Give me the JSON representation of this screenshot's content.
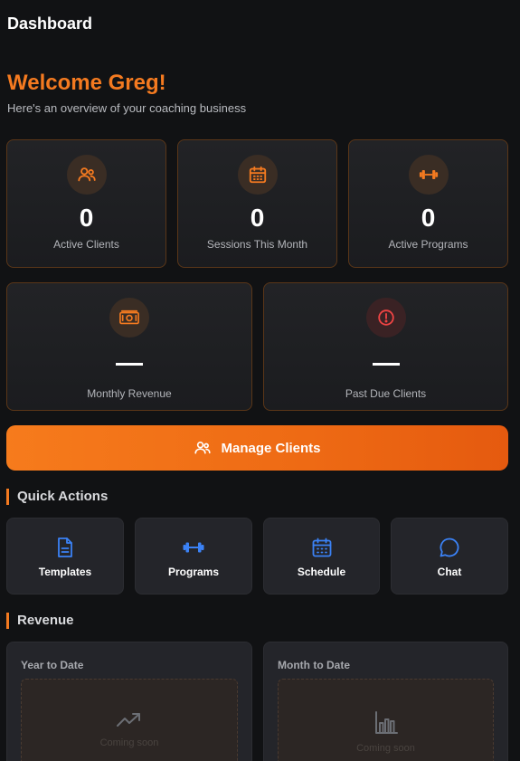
{
  "header": {
    "title": "Dashboard"
  },
  "welcome": {
    "title": "Welcome Greg!",
    "subtitle": "Here's an overview of your coaching business"
  },
  "stats": [
    {
      "value": "0",
      "label": "Active Clients",
      "icon": "users-icon"
    },
    {
      "value": "0",
      "label": "Sessions This Month",
      "icon": "calendar-icon"
    },
    {
      "value": "0",
      "label": "Active Programs",
      "icon": "dumbbell-icon"
    },
    {
      "value": "—",
      "label": "Monthly Revenue",
      "icon": "money-icon"
    },
    {
      "value": "—",
      "label": "Past Due Clients",
      "icon": "alert-icon"
    }
  ],
  "manage_button": {
    "label": "Manage Clients",
    "icon": "users-icon"
  },
  "quick_actions": {
    "title": "Quick Actions",
    "items": [
      {
        "label": "Templates",
        "icon": "document-icon"
      },
      {
        "label": "Programs",
        "icon": "dumbbell-icon"
      },
      {
        "label": "Schedule",
        "icon": "calendar-icon"
      },
      {
        "label": "Chat",
        "icon": "chat-icon"
      }
    ]
  },
  "revenue": {
    "title": "Revenue",
    "cards": [
      {
        "title": "Year to Date",
        "placeholder": "Coming soon",
        "icon": "trending-up-icon"
      },
      {
        "title": "Month to Date",
        "placeholder": "Coming soon",
        "icon": "bar-chart-icon"
      }
    ]
  },
  "colors": {
    "accent": "#f47a20",
    "background": "#111214",
    "card": "#1f2023",
    "quick_action_icon": "#3b82f6",
    "danger": "#ef4444"
  }
}
